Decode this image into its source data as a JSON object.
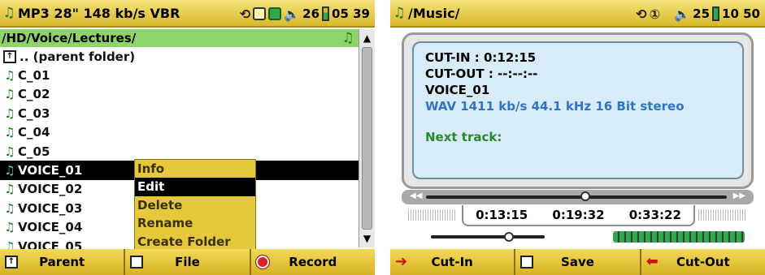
{
  "left": {
    "topbar": {
      "title": "MP3 28\" 148 kb/s VBR",
      "volume": "26",
      "time": "05 39"
    },
    "path": "/HD/Voice/Lectures/",
    "files": [
      {
        "name": ".. (parent folder)",
        "type": "parent"
      },
      {
        "name": "C_01",
        "type": "audio"
      },
      {
        "name": "C_02",
        "type": "audio"
      },
      {
        "name": "C_03",
        "type": "audio"
      },
      {
        "name": "C_04",
        "type": "audio"
      },
      {
        "name": "C_05",
        "type": "audio"
      },
      {
        "name": "VOICE_01",
        "type": "audio",
        "selected": true
      },
      {
        "name": "VOICE_02",
        "type": "audio"
      },
      {
        "name": "VOICE_03",
        "type": "audio"
      },
      {
        "name": "VOICE_04",
        "type": "audio"
      },
      {
        "name": "VOICE_05",
        "type": "audio"
      }
    ],
    "menu": [
      "Info",
      "Edit",
      "Delete",
      "Rename",
      "Create Folder"
    ],
    "menu_selected": "Edit",
    "softkeys": [
      "Parent",
      "File",
      "Record"
    ]
  },
  "right": {
    "topbar": {
      "title": "/Music/",
      "volume": "25",
      "time": "10 50"
    },
    "cut_in": "CUT-IN :  0:12:15",
    "cut_out": "CUT-OUT : --:--:--",
    "filename": "VOICE_01",
    "format": "WAV 1411 kb/s 44.1 kHz 16 Bit stereo",
    "next": "Next track:",
    "times": [
      "0:13:15",
      "0:19:32",
      "0:33:22"
    ],
    "softkeys": [
      "Cut-In",
      "Save",
      "Cut-Out"
    ]
  }
}
